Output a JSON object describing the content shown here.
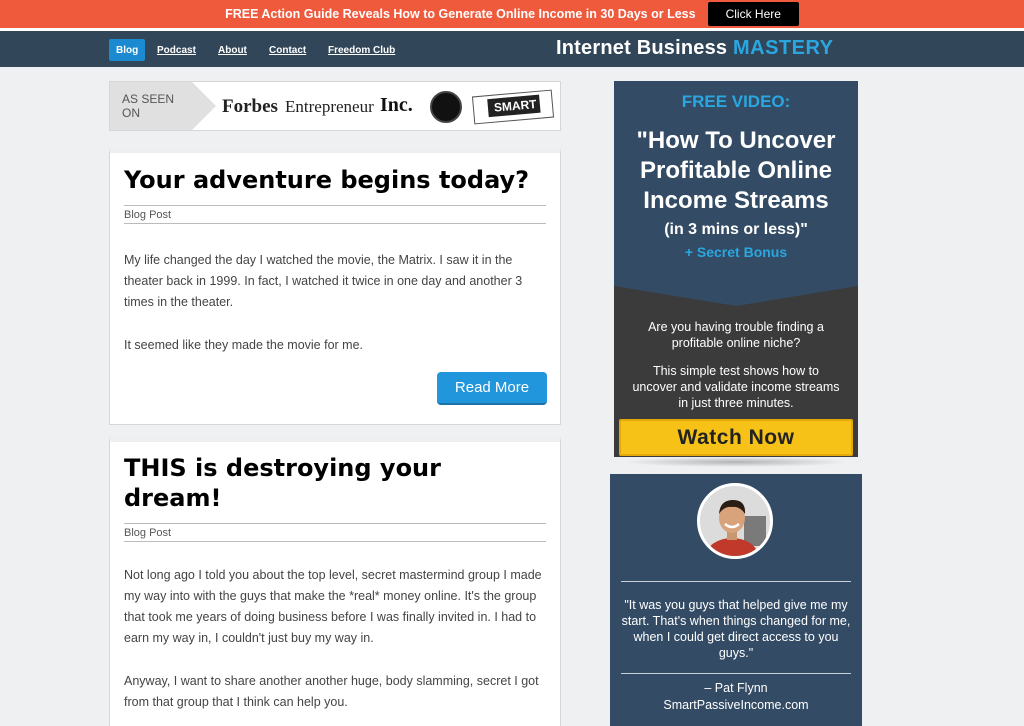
{
  "promo": {
    "text": "FREE Action Guide Reveals How to Generate Online Income in 30 Days or Less",
    "button": "Click Here"
  },
  "nav": {
    "items": [
      "Blog",
      "Podcast",
      "About",
      "Contact",
      "Freedom Club"
    ],
    "logo_a": "Internet Business ",
    "logo_b": "MASTERY"
  },
  "as_seen_on": {
    "label": "AS SEEN ON",
    "logos": [
      "Forbes",
      "Entrepreneur",
      "Inc.",
      "SMART"
    ]
  },
  "posts": [
    {
      "title": "Your adventure begins today?",
      "meta": "Blog Post",
      "p1": "My life changed the day I watched the movie, the Matrix. I saw it in the theater back in 1999. In fact, I watched it twice in one day and another 3 times in the theater.",
      "p2": "It seemed like they made the movie for me.",
      "button": "Read More"
    },
    {
      "title": "THIS is destroying your dream!",
      "meta": "Blog Post",
      "p1": "Not long ago I told you about the top level, secret mastermind group I made my way into with the guys that make the *real* money online. It's the group that took me years of doing business before I was finally invited in. I had to earn my way in, I couldn't just buy my way in.",
      "p2": "Anyway, I want to share another another huge, body slamming, secret I got from that group that I think can help you."
    }
  ],
  "ad": {
    "free_video": "FREE VIDEO:",
    "headline": "\"How To Uncover Profitable Online Income Streams",
    "sub": "(in 3 mins or less)\"",
    "bonus": "+ Secret Bonus",
    "question": "Are you having trouble finding a profitable online niche?",
    "body": "This simple test shows how to uncover and validate income streams in just three minutes.",
    "button": "Watch Now"
  },
  "testimonial": {
    "quote": "\"It was you guys that helped give me my start. That's when things changed for me, when I could get direct access to you guys.\"",
    "author": "– Pat Flynn",
    "site": "SmartPassiveIncome.com"
  }
}
